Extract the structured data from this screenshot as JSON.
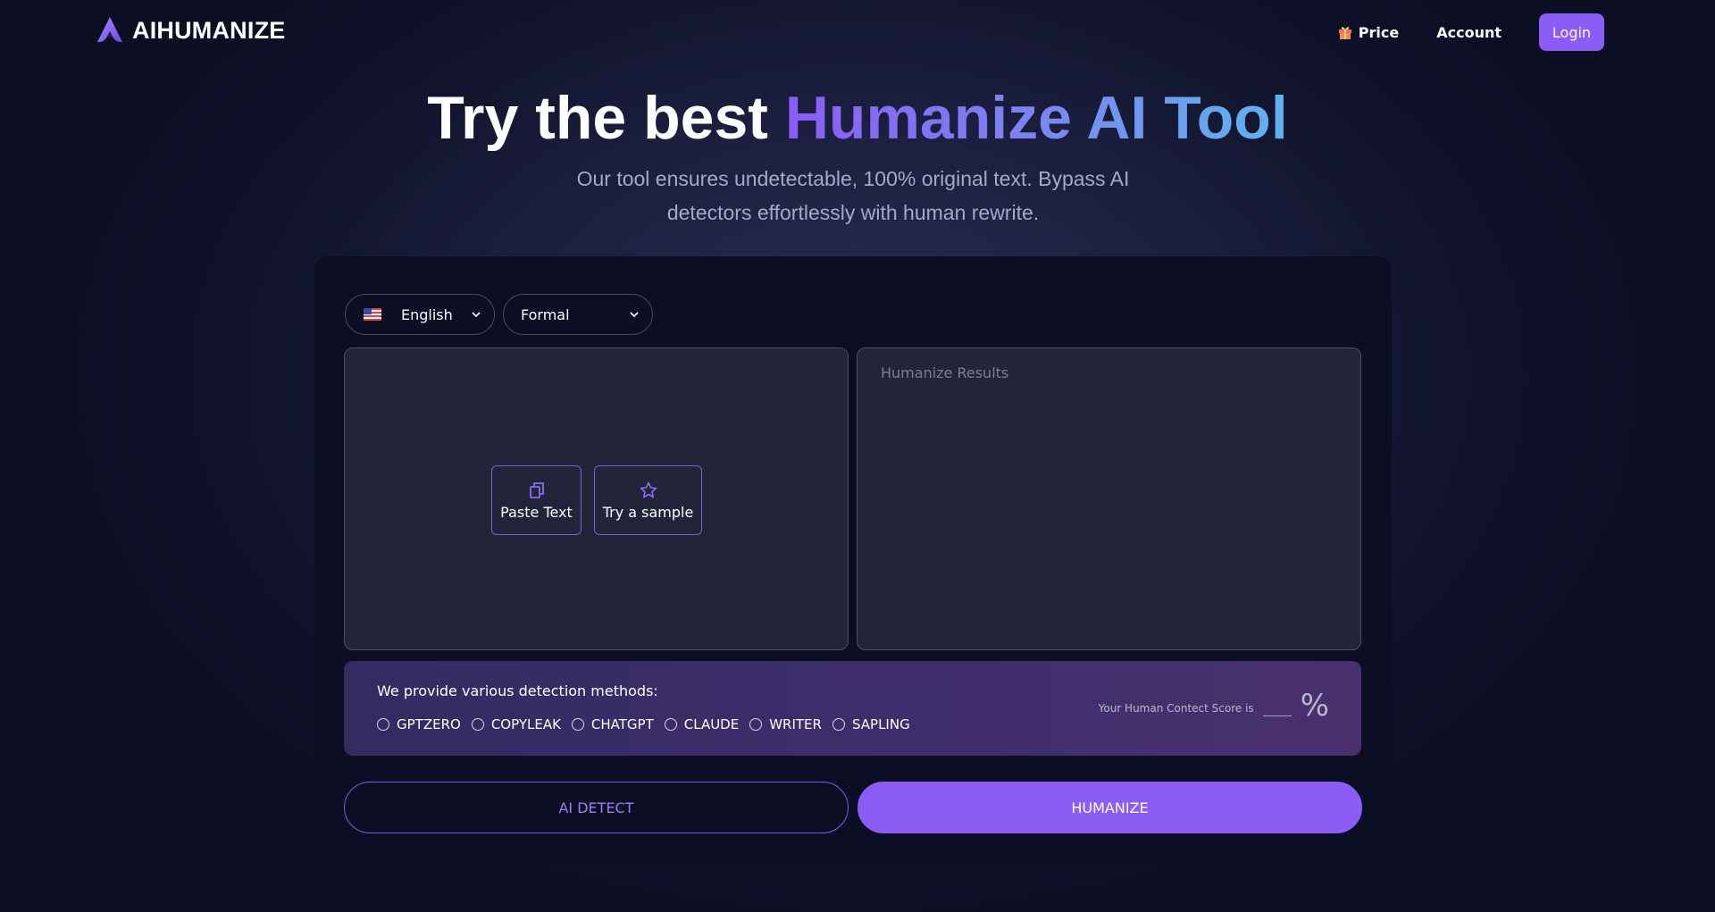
{
  "header": {
    "brand": "AIHUMANIZE",
    "nav": [
      {
        "label": "Price",
        "icon": "gift-icon"
      },
      {
        "label": "Account"
      }
    ],
    "login_label": "Login"
  },
  "hero": {
    "title_plain": "Try the best ",
    "title_accent": "Humanize AI Tool",
    "subtitle": "Our tool ensures undetectable, 100% original text. Bypass AI detectors effortlessly with human rewrite."
  },
  "tool": {
    "language": {
      "selected": "English",
      "icon": "us-flag-icon"
    },
    "tone": {
      "selected": "Formal"
    },
    "input_actions": [
      {
        "label": "Paste Text",
        "icon": "copy-icon"
      },
      {
        "label": "Try a sample",
        "icon": "star-icon"
      }
    ],
    "output_placeholder": "Humanize Results",
    "detection": {
      "label": "We provide various detection methods:",
      "methods": [
        "GPTZERO",
        "COPYLEAK",
        "CHATGPT",
        "CLAUDE",
        "WRITER",
        "SAPLING"
      ],
      "score_label": "Your Human Contect Score is",
      "score_unit": "%"
    },
    "buttons": {
      "detect": "AI DETECT",
      "humanize": "HUMANIZE"
    }
  },
  "colors": {
    "accent": "#8b5cf6",
    "background": "#10122a",
    "card": "#0c0e23",
    "panel": "#222538"
  }
}
